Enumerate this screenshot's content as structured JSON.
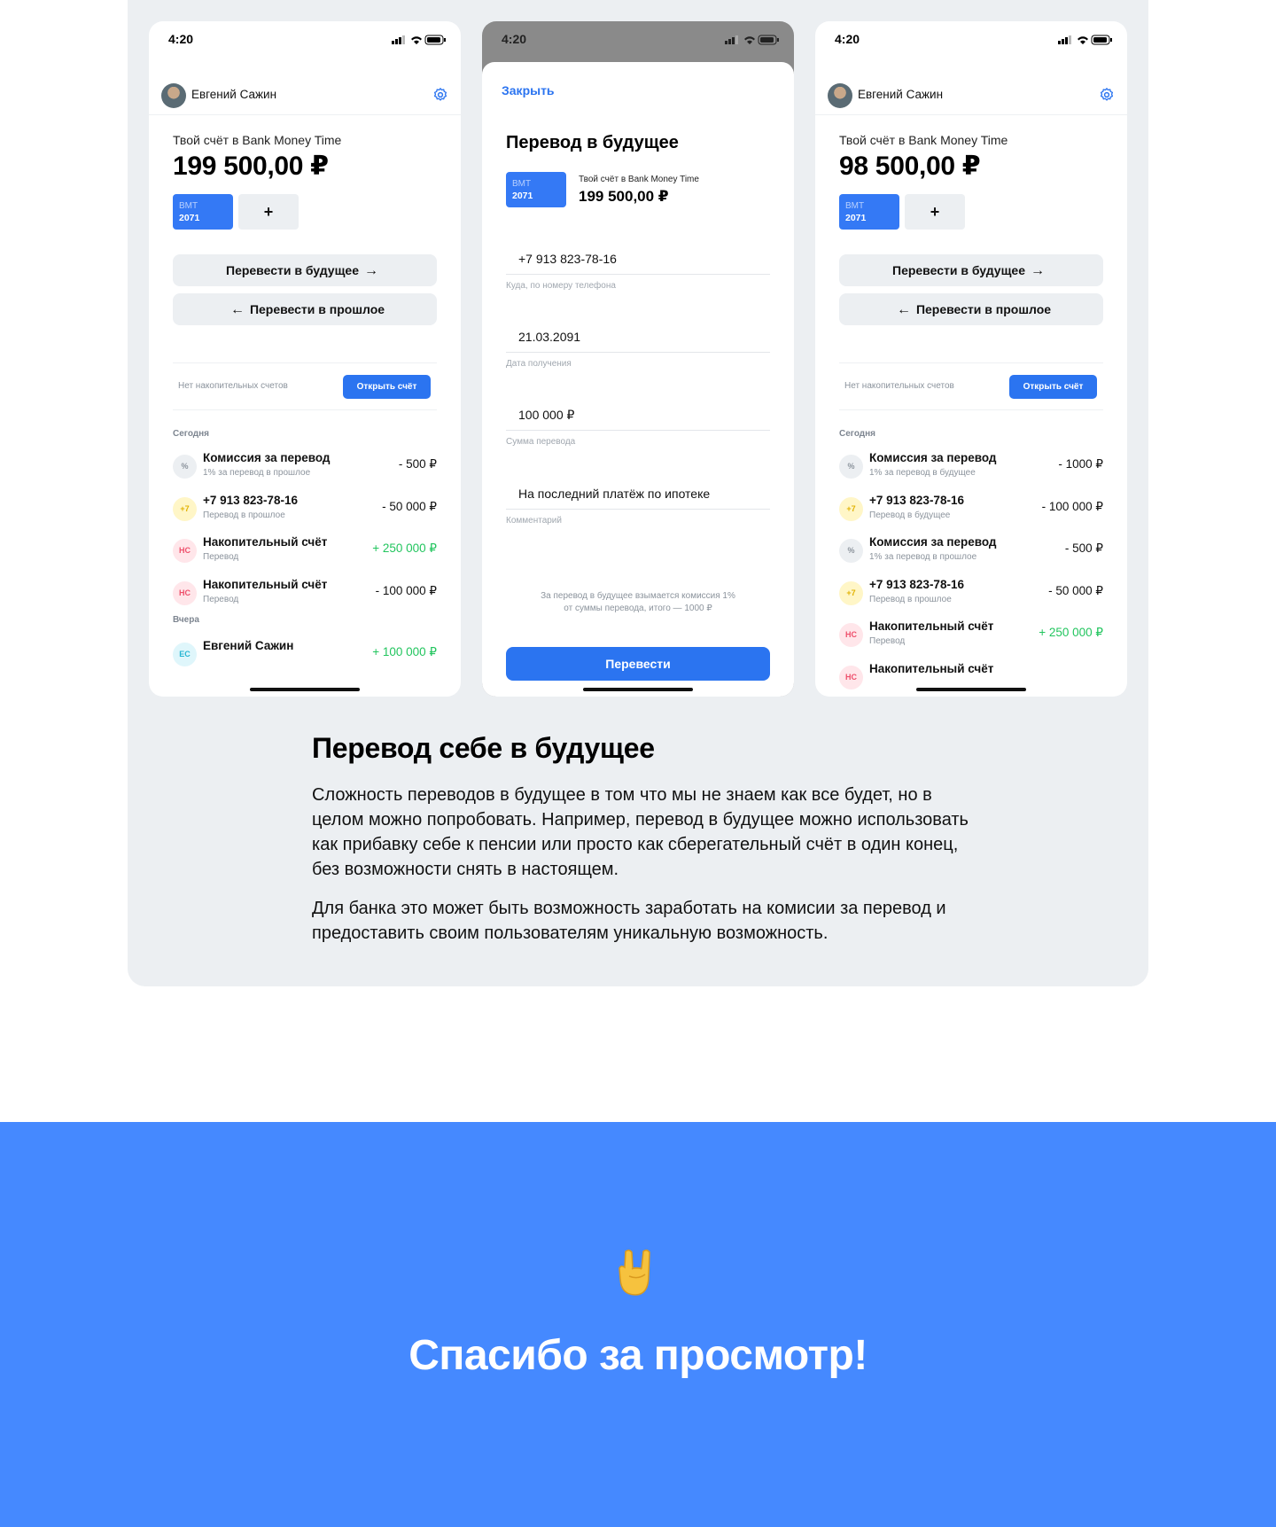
{
  "status_bar": {
    "time": "4:20"
  },
  "user": {
    "name": "Евгений Сажин"
  },
  "phone1": {
    "account_label": "Твой счёт в Bank Money Time",
    "balance": "199 500,00 ₽",
    "card": {
      "top": "BMT",
      "bottom": "2071"
    },
    "add_card": "+",
    "btn_future": "Перевести в будущее",
    "btn_past": "Перевести в прошлое",
    "savings_empty": "Нет накопительных счетов",
    "open_account": "Открыть счёт",
    "section_today": "Сегодня",
    "section_yesterday": "Вчера",
    "transactions": [
      {
        "icon": "%",
        "title": "Комиссия за перевод",
        "sub": "1% за перевод в прошлое",
        "amount": "- 500 ₽",
        "positive": false
      },
      {
        "icon": "+7",
        "title": "+7 913 823-78-16",
        "sub": "Перевод в прошлое",
        "amount": "- 50 000 ₽",
        "positive": false
      },
      {
        "icon": "НС",
        "title": "Накопительный счёт",
        "sub": "Перевод",
        "amount": "+ 250 000 ₽",
        "positive": true
      },
      {
        "icon": "НС",
        "title": "Накопительный счёт",
        "sub": "Перевод",
        "amount": "- 100 000 ₽",
        "positive": false
      }
    ],
    "yesterday_tx": {
      "icon": "ЕС",
      "title": "Евгений Сажин",
      "amount": "+ 100 000 ₽"
    }
  },
  "phone2": {
    "close": "Закрыть",
    "title": "Перевод в будущее",
    "card": {
      "top": "BMT",
      "bottom": "2071"
    },
    "account_label": "Твой счёт в Bank Money Time",
    "balance": "199 500,00 ₽",
    "fields": [
      {
        "value": "+7 913 823-78-16",
        "hint": "Куда, по номеру телефона"
      },
      {
        "value": "21.03.2091",
        "hint": "Дата получения"
      },
      {
        "value": "100 000 ₽",
        "hint": "Сумма перевода"
      },
      {
        "value": "На последний платёж по ипотеке",
        "hint": "Комментарий"
      }
    ],
    "fee_line1": "За перевод в будущее взымается комиссия 1%",
    "fee_line2": "от суммы перевода, итого — 1000 ₽",
    "submit": "Перевести"
  },
  "phone3": {
    "account_label": "Твой счёт в Bank Money Time",
    "balance": "98 500,00 ₽",
    "card": {
      "top": "BMT",
      "bottom": "2071"
    },
    "add_card": "+",
    "btn_future": "Перевести в будущее",
    "btn_past": "Перевести в прошлое",
    "savings_empty": "Нет накопительных счетов",
    "open_account": "Открыть счёт",
    "section_today": "Сегодня",
    "transactions": [
      {
        "icon": "%",
        "title": "Комиссия за перевод",
        "sub": "1% за перевод в будущее",
        "amount": "- 1000 ₽",
        "positive": false
      },
      {
        "icon": "+7",
        "title": "+7 913 823-78-16",
        "sub": "Перевод в будущее",
        "amount": "- 100 000 ₽",
        "positive": false
      },
      {
        "icon": "%",
        "title": "Комиссия за перевод",
        "sub": "1% за перевод в прошлое",
        "amount": "- 500 ₽",
        "positive": false
      },
      {
        "icon": "+7",
        "title": "+7 913 823-78-16",
        "sub": "Перевод в прошлое",
        "amount": "- 50 000 ₽",
        "positive": false
      },
      {
        "icon": "НС",
        "title": "Накопительный счёт",
        "sub": "Перевод",
        "amount": "+ 250 000 ₽",
        "positive": true
      },
      {
        "icon": "НС",
        "title": "Накопительный счёт",
        "sub": "",
        "amount": "",
        "positive": false
      }
    ]
  },
  "description": {
    "title": "Перевод себе в будущее",
    "p1": "Сложность переводов в будущее в том что мы не знаем как все будет, но в целом можно попробовать. Например, перевод в будущее можно использовать как прибавку себе к пенсии или просто как сберегательный счёт в один конец, без возможности снять в настоящем.",
    "p2": "Для банка это может быть возможность заработать на комисии за перевод и предоставить своим пользователям уникальную возможность."
  },
  "footer": {
    "thanks": "Спасибо за просмотр!",
    "emoji_icon": "sign-of-horns-icon"
  },
  "colors": {
    "accent": "#2b74f0",
    "positive": "#22c55e",
    "footer_bg": "#4589ff",
    "panel_bg": "#eceff2"
  }
}
